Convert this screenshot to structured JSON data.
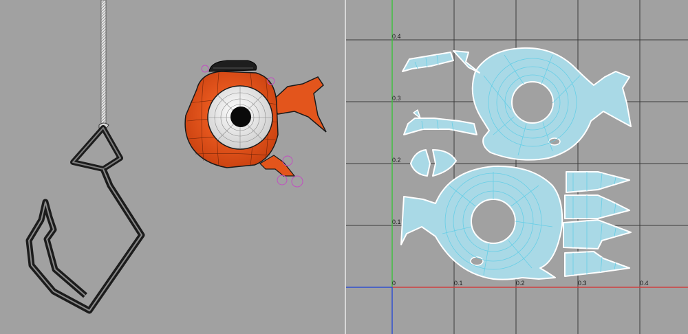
{
  "left_viewport": {
    "objects": [
      "fishing-hook",
      "cartoon-fish"
    ]
  },
  "uv_editor": {
    "u_ticks": [
      "0",
      "0.1",
      "0.2",
      "0.3",
      "0.4"
    ],
    "v_ticks": [
      "0.1",
      "0.2",
      "0.3",
      "0.4"
    ],
    "colors": {
      "background": "#a1a1a1",
      "grid": "#3a3a3a",
      "u_axis": "#d04040",
      "v_axis": "#40c040",
      "origin_axis": "#3050d0",
      "shell_fill": "#a9d9e6",
      "shell_wire": "#5fcde6",
      "shell_border": "#ffffff"
    }
  }
}
